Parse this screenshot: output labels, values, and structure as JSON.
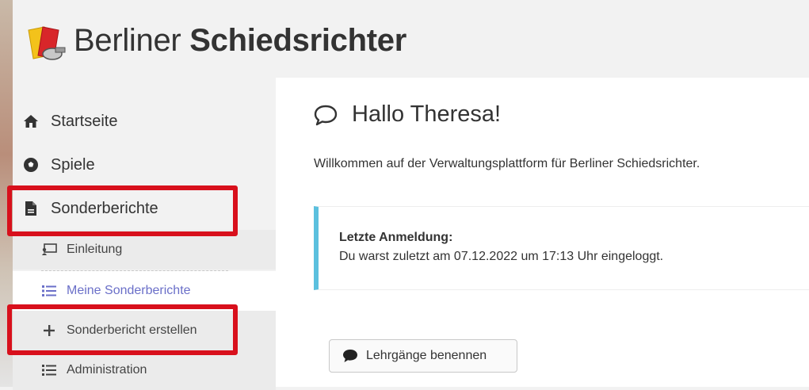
{
  "brand": {
    "light": "Berliner",
    "bold": "Schiedsrichter",
    "logo_icon": "yellow-red-cards-whistle-icon"
  },
  "sidebar": {
    "items": [
      {
        "label": "Startseite",
        "icon": "home-icon"
      },
      {
        "label": "Spiele",
        "icon": "soccer-ball-icon"
      },
      {
        "label": "Sonderberichte",
        "icon": "document-icon"
      }
    ],
    "subitems": [
      {
        "label": "Einleitung",
        "icon": "presentation-icon"
      },
      {
        "label": "Meine Sonderberichte",
        "icon": "list-icon",
        "active": true
      },
      {
        "label": "Sonderbericht erstellen",
        "icon": "plus-icon"
      },
      {
        "label": "Administration",
        "icon": "list-icon"
      }
    ]
  },
  "main": {
    "greeting": "Hallo Theresa!",
    "welcome": "Willkommen auf der Verwaltungsplattform für Berliner Schiedsrichter.",
    "last_login_title": "Letzte Anmeldung:",
    "last_login_text": "Du warst zuletzt am 07.12.2022 um 17:13 Uhr eingeloggt.",
    "button_label": "Lehrgänge benennen"
  },
  "colors": {
    "highlight": "#d8101c",
    "accent": "#6a6fc8",
    "callout": "#5bc0de"
  }
}
